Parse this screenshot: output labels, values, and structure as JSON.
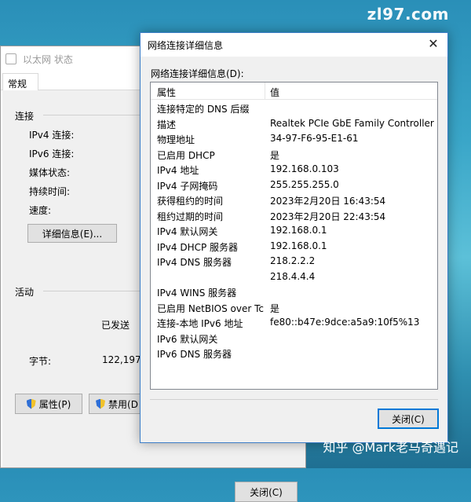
{
  "watermark": {
    "top": "zl97.com",
    "bottom": "知乎 @Mark老马奇遇记"
  },
  "status_window": {
    "title": "以太网 状态",
    "tab": "常规",
    "connection_group": "连接",
    "ipv4_label": "IPv4 连接:",
    "ipv6_label": "IPv6 连接:",
    "media_label": "媒体状态:",
    "duration_label": "持续时间:",
    "speed_label": "速度:",
    "details_button": "详细信息(E)...",
    "activity_group": "活动",
    "sent_label": "已发送",
    "bytes_label": "字节:",
    "bytes_value": "122,197,5",
    "properties_button": "属性(P)",
    "disable_button": "禁用(D",
    "close_button": "关闭(C)"
  },
  "details_dialog": {
    "title": "网络连接详细信息",
    "caption": "网络连接详细信息(D):",
    "col_property": "属性",
    "col_value": "值",
    "rows": [
      {
        "k": "连接特定的 DNS 后缀",
        "v": ""
      },
      {
        "k": "描述",
        "v": "Realtek PCIe GbE Family Controller"
      },
      {
        "k": "物理地址",
        "v": "34-97-F6-95-E1-61"
      },
      {
        "k": "已启用 DHCP",
        "v": "是"
      },
      {
        "k": "IPv4 地址",
        "v": "192.168.0.103"
      },
      {
        "k": "IPv4 子网掩码",
        "v": "255.255.255.0"
      },
      {
        "k": "获得租约的时间",
        "v": "2023年2月20日 16:43:54"
      },
      {
        "k": "租约过期的时间",
        "v": "2023年2月20日 22:43:54"
      },
      {
        "k": "IPv4 默认网关",
        "v": "192.168.0.1"
      },
      {
        "k": "IPv4 DHCP 服务器",
        "v": "192.168.0.1"
      },
      {
        "k": "IPv4 DNS 服务器",
        "v": "218.2.2.2"
      },
      {
        "k": "",
        "v": "218.4.4.4"
      },
      {
        "k": "IPv4 WINS 服务器",
        "v": ""
      },
      {
        "k": "已启用 NetBIOS over Tc...",
        "v": "是"
      },
      {
        "k": "连接-本地 IPv6 地址",
        "v": "fe80::b47e:9dce:a5a9:10f5%13"
      },
      {
        "k": "IPv6 默认网关",
        "v": ""
      },
      {
        "k": "IPv6 DNS 服务器",
        "v": ""
      }
    ],
    "close_button": "关闭(C)"
  }
}
